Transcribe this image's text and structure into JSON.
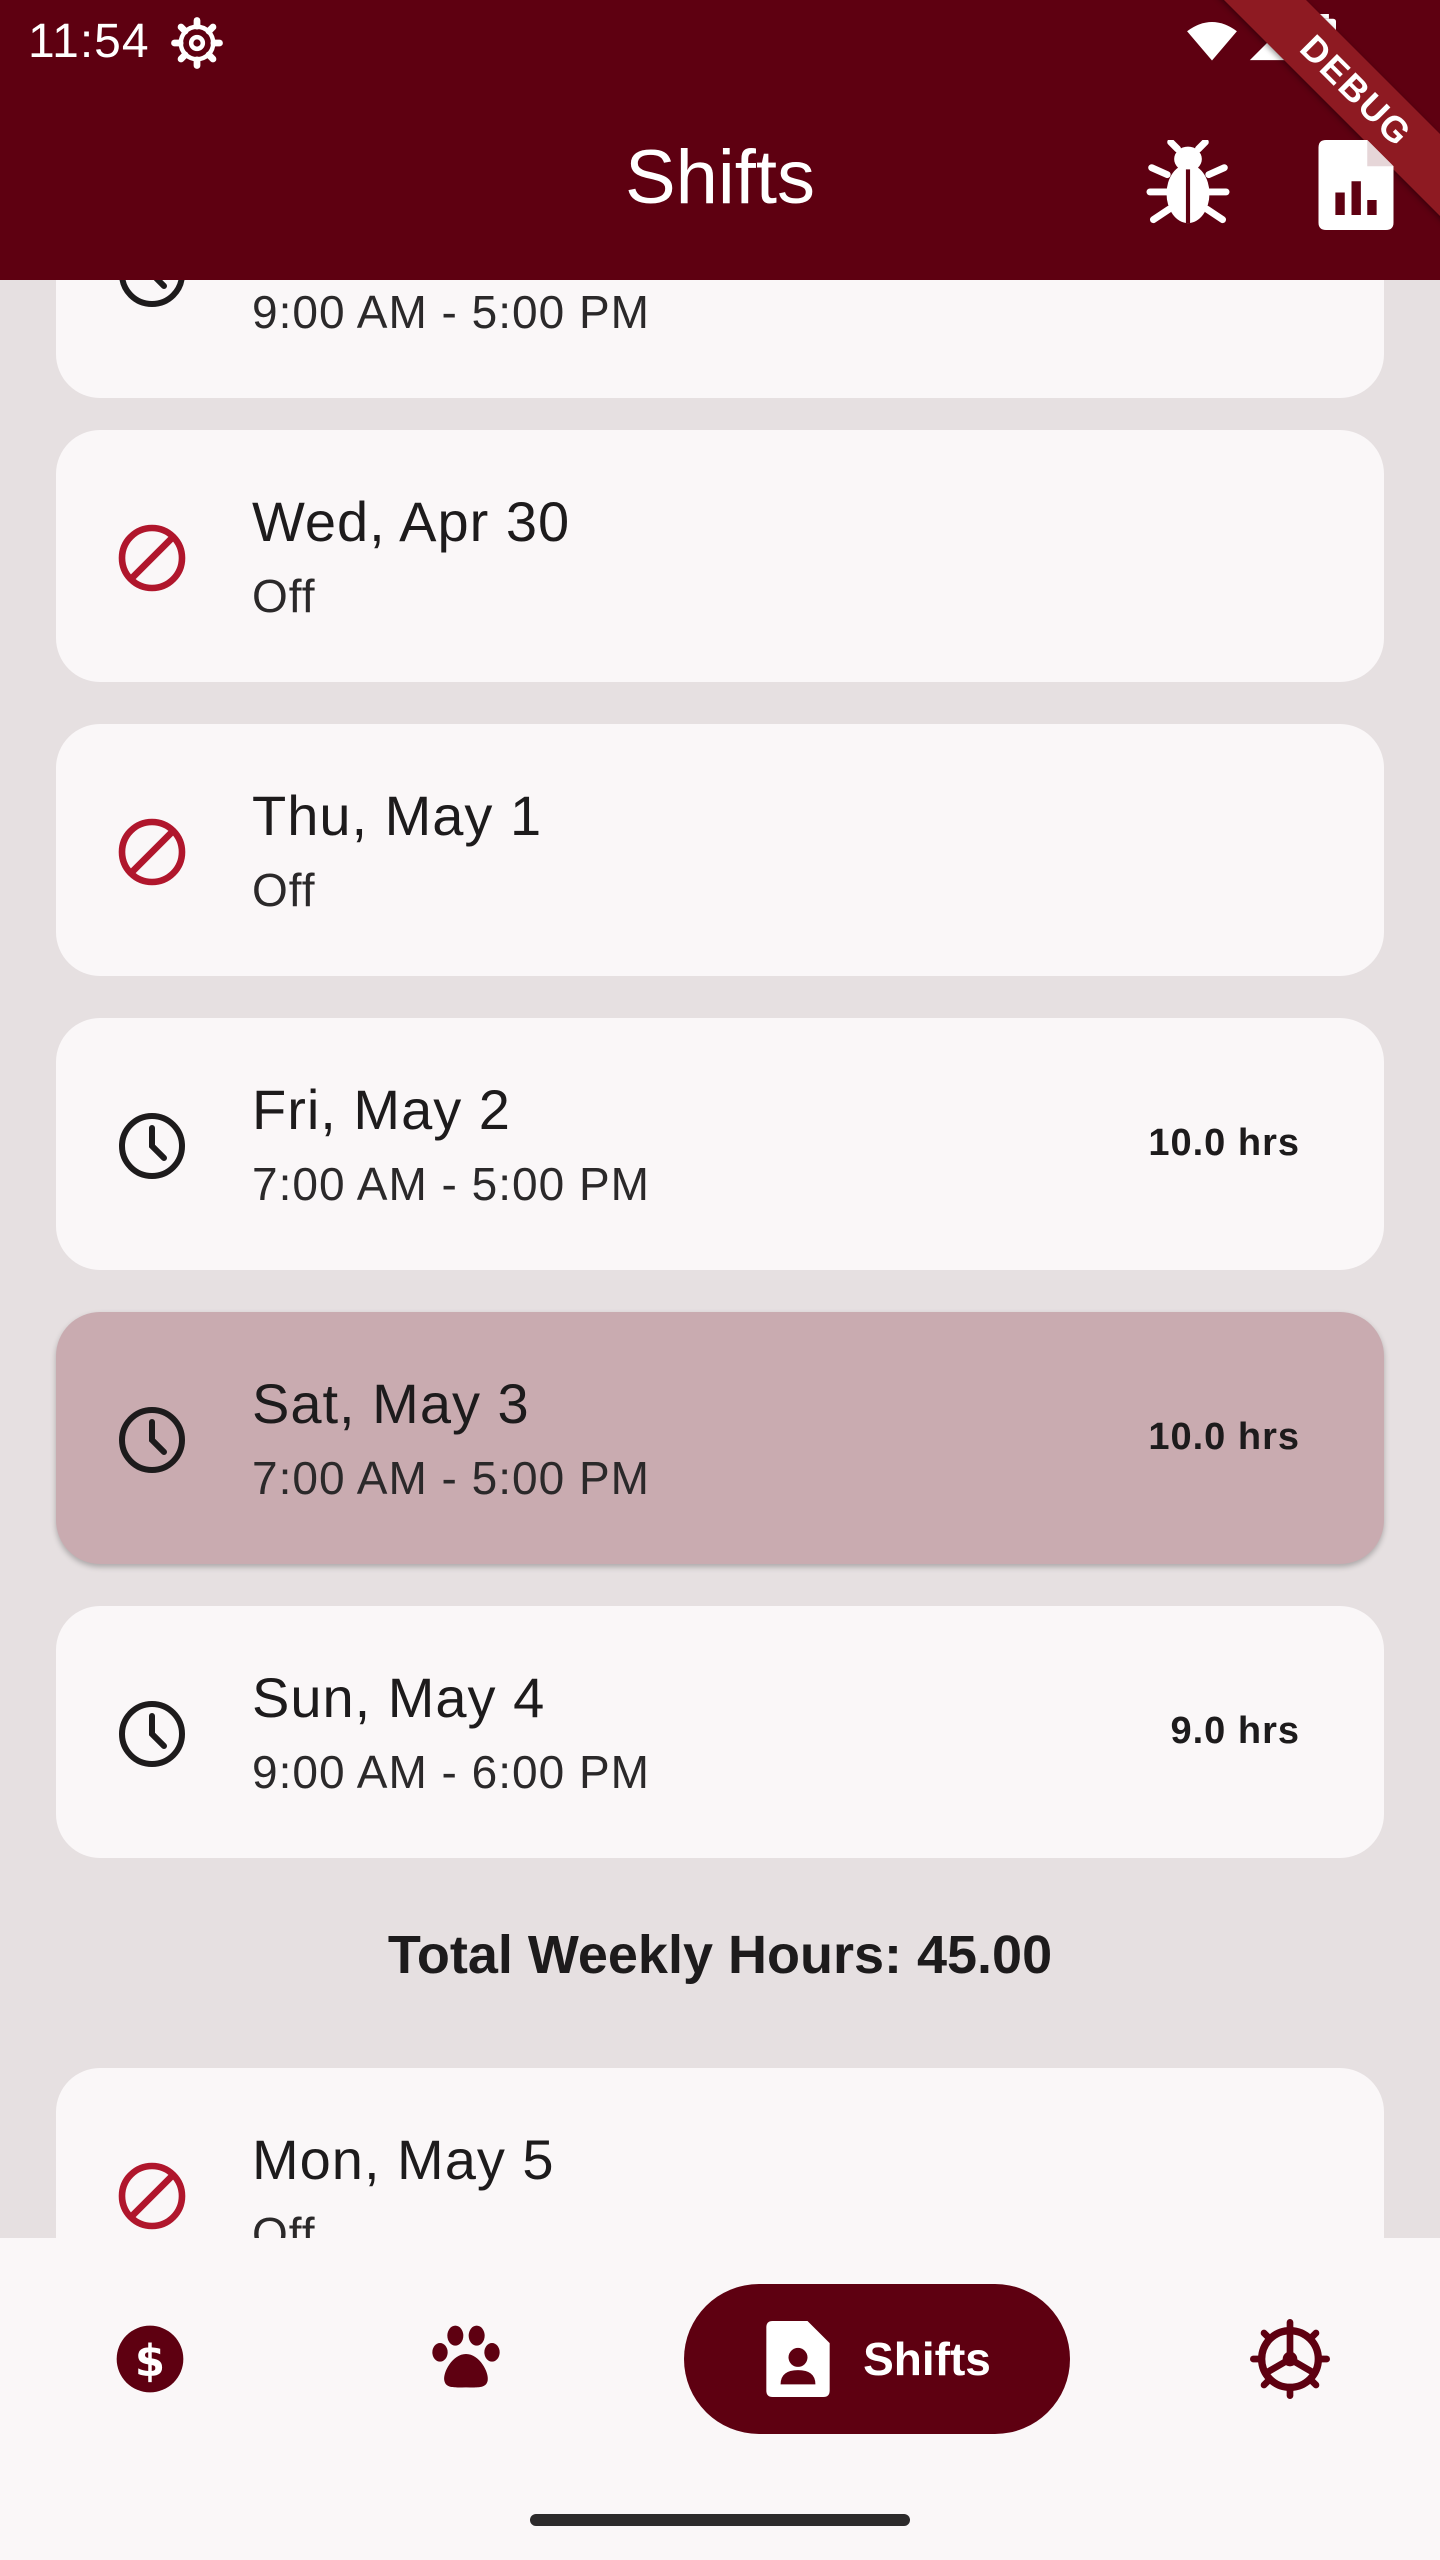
{
  "status_bar": {
    "time": "11:54",
    "icons": [
      "settings-gear-icon",
      "wifi-icon",
      "signal-icon",
      "battery-icon"
    ]
  },
  "debug_banner": "DEBUG",
  "app_bar": {
    "title": "Shifts",
    "actions": [
      "bug-icon",
      "report-chart-icon"
    ]
  },
  "colors": {
    "primary": "#5e0011",
    "background": "#e6e0e1",
    "card": "#faf7f8",
    "selected_card": "#c9abb0",
    "off_icon": "#b0162c"
  },
  "shifts": [
    {
      "date": "",
      "detail": "9:00 AM - 5:00 PM",
      "hours": "",
      "icon": "clock-icon",
      "selected": false
    },
    {
      "date": "Wed, Apr 30",
      "detail": "Off",
      "hours": "",
      "icon": "off-icon",
      "selected": false
    },
    {
      "date": "Thu, May 1",
      "detail": "Off",
      "hours": "",
      "icon": "off-icon",
      "selected": false
    },
    {
      "date": "Fri, May 2",
      "detail": "7:00 AM - 5:00 PM",
      "hours": "10.0 hrs",
      "icon": "clock-icon",
      "selected": false
    },
    {
      "date": "Sat, May 3",
      "detail": "7:00 AM - 5:00 PM",
      "hours": "10.0 hrs",
      "icon": "clock-icon",
      "selected": true
    },
    {
      "date": "Sun, May 4",
      "detail": "9:00 AM - 6:00 PM",
      "hours": "9.0 hrs",
      "icon": "clock-icon",
      "selected": false
    }
  ],
  "total_weekly_hours": "Total Weekly Hours: 45.00",
  "next_week": [
    {
      "date": "Mon, May 5",
      "detail": "Off",
      "icon": "off-icon"
    }
  ],
  "bottom_nav": {
    "items": [
      {
        "icon": "dollar-icon",
        "label": "",
        "active": false
      },
      {
        "icon": "paw-icon",
        "label": "",
        "active": false
      },
      {
        "icon": "shift-badge-icon",
        "label": "Shifts",
        "active": true
      },
      {
        "icon": "settings-wheel-icon",
        "label": "",
        "active": false
      }
    ]
  }
}
